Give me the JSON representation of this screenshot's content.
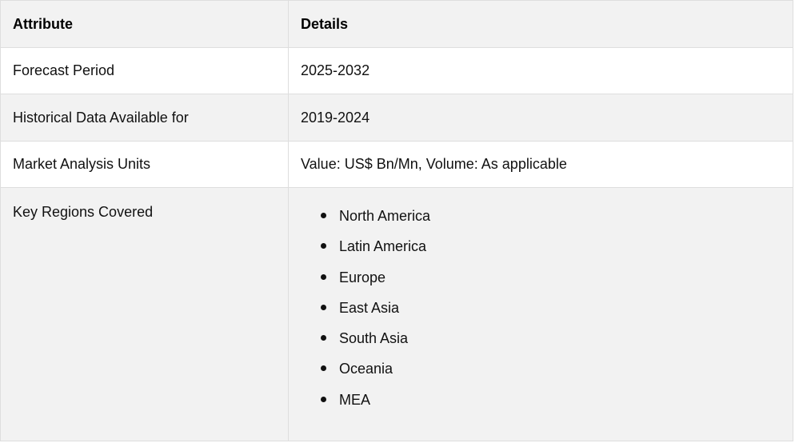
{
  "table": {
    "headers": [
      "Attribute",
      "Details"
    ],
    "rows": [
      {
        "attribute": "Forecast Period",
        "details": "2025-2032"
      },
      {
        "attribute": "Historical Data Available for",
        "details": "2019-2024"
      },
      {
        "attribute": "Market Analysis Units",
        "details": "Value: US$ Bn/Mn, Volume: As applicable"
      },
      {
        "attribute": "Key Regions Covered",
        "details_list": [
          "North America",
          "Latin America",
          "Europe",
          "East Asia",
          "South Asia",
          "Oceania",
          "MEA"
        ]
      }
    ]
  }
}
